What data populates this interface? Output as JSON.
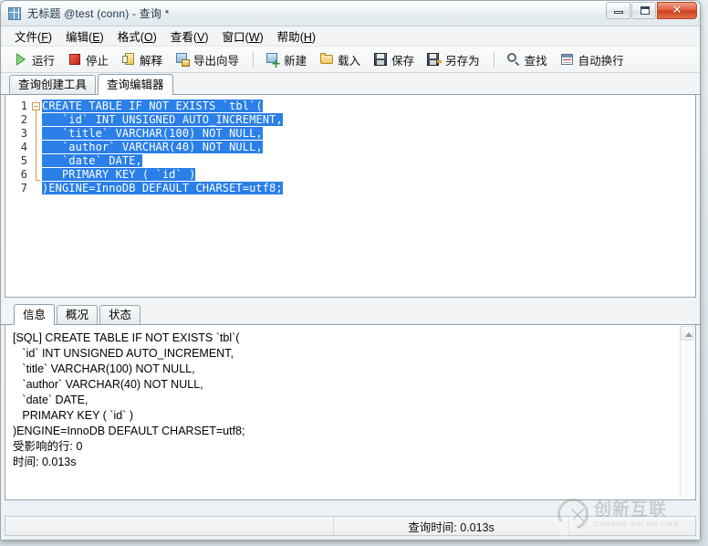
{
  "window": {
    "title": "无标题 @test (conn) - 查询 *",
    "app_icon": "table-grid-icon",
    "buttons": {
      "minimize": "minimize-icon",
      "maximize": "maximize-icon",
      "close": "✕"
    }
  },
  "menubar": {
    "items": [
      {
        "label": "文件",
        "mnemonic": "F"
      },
      {
        "label": "编辑",
        "mnemonic": "E"
      },
      {
        "label": "格式",
        "mnemonic": "O"
      },
      {
        "label": "查看",
        "mnemonic": "V"
      },
      {
        "label": "窗口",
        "mnemonic": "W"
      },
      {
        "label": "帮助",
        "mnemonic": "H"
      }
    ]
  },
  "toolbar": {
    "groups": [
      [
        {
          "label": "运行",
          "icon": "play-icon"
        },
        {
          "label": "停止",
          "icon": "stop-icon"
        },
        {
          "label": "解释",
          "icon": "explain-icon"
        },
        {
          "label": "导出向导",
          "icon": "export-wizard-icon"
        }
      ],
      [
        {
          "label": "新建",
          "icon": "new-query-icon"
        },
        {
          "label": "载入",
          "icon": "folder-open-icon"
        },
        {
          "label": "保存",
          "icon": "save-icon"
        },
        {
          "label": "另存为",
          "icon": "save-as-icon"
        }
      ],
      [
        {
          "label": "查找",
          "icon": "search-icon"
        },
        {
          "label": "自动换行",
          "icon": "word-wrap-icon"
        }
      ]
    ]
  },
  "editor_tabs": [
    {
      "label": "查询创建工具",
      "active": false
    },
    {
      "label": "查询编辑器",
      "active": true
    }
  ],
  "editor": {
    "line_numbers": [
      "1",
      "2",
      "3",
      "4",
      "5",
      "6",
      "7"
    ],
    "selection_color": "#2a7fe8",
    "lines": [
      "CREATE TABLE IF NOT EXISTS `tbl`(",
      "   `id` INT UNSIGNED AUTO_INCREMENT,",
      "   `title` VARCHAR(100) NOT NULL,",
      "   `author` VARCHAR(40) NOT NULL,",
      "   `date` DATE,",
      "   PRIMARY KEY ( `id` )",
      ")ENGINE=InnoDB DEFAULT CHARSET=utf8;"
    ]
  },
  "result_tabs": [
    {
      "label": "信息",
      "active": true
    },
    {
      "label": "概况",
      "active": false
    },
    {
      "label": "状态",
      "active": false
    }
  ],
  "info_panel": {
    "text": "[SQL] CREATE TABLE IF NOT EXISTS `tbl`(\n   `id` INT UNSIGNED AUTO_INCREMENT,\n   `title` VARCHAR(100) NOT NULL,\n   `author` VARCHAR(40) NOT NULL,\n   `date` DATE,\n   PRIMARY KEY ( `id` )\n)ENGINE=InnoDB DEFAULT CHARSET=utf8;\n受影响的行: 0\n时间: 0.013s",
    "scroll_up_icon": "scroll-up-arrow-icon"
  },
  "statusbar": {
    "left": "",
    "middle": "查询时间: 0.013s",
    "right": ""
  },
  "watermark": {
    "cn": "创新互联",
    "en": "CHUANG XIN HU LIAN"
  }
}
